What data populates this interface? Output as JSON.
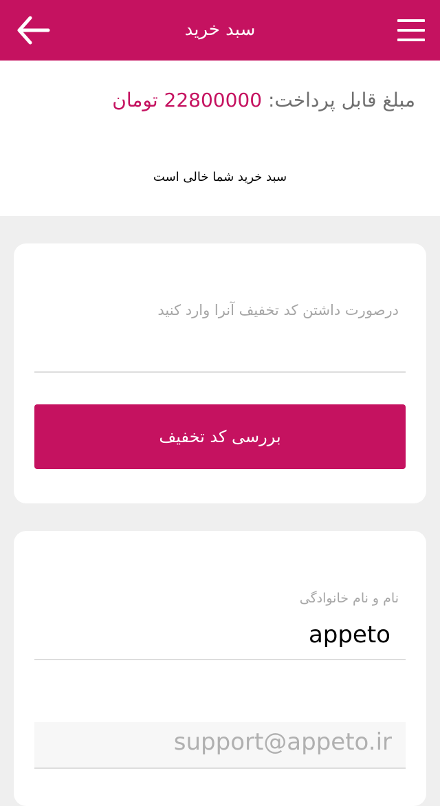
{
  "header": {
    "title": "سبد خرید",
    "back_icon": "arrow-left-icon",
    "menu_icon": "hamburger-menu-icon",
    "background_color": "#c51260"
  },
  "summary": {
    "amount_label": "مبلغ قابل پرداخت:",
    "amount_value": "22800000 تومان",
    "empty_message": "سبد خرید شما خالی است"
  },
  "discount": {
    "placeholder": "درصورت داشتن کد تخفیف آنرا وارد کنید",
    "value": "",
    "button_label": "بررسی کد تخفیف"
  },
  "customer": {
    "name_label": "نام و نام خانوادگی",
    "name_value": "appeto",
    "email_value": "support@appeto.ir"
  },
  "colors": {
    "accent": "#c51260",
    "page_background": "#efefef"
  }
}
